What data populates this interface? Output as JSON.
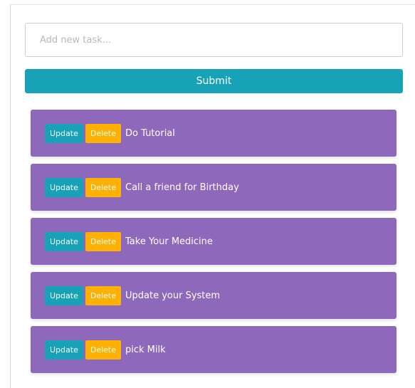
{
  "form": {
    "input_value": "",
    "input_placeholder": "Add new task...",
    "submit_label": "Submit"
  },
  "tasks": [
    {
      "update_label": "Update",
      "delete_label": "Delete",
      "text": "Do Tutorial"
    },
    {
      "update_label": "Update",
      "delete_label": "Delete",
      "text": "Call a friend for Birthday"
    },
    {
      "update_label": "Update",
      "delete_label": "Delete",
      "text": "Take Your Medicine"
    },
    {
      "update_label": "Update",
      "delete_label": "Delete",
      "text": "Update your System"
    },
    {
      "update_label": "Update",
      "delete_label": "Delete",
      "text": "pick Milk"
    }
  ],
  "colors": {
    "primary": "#17a2b8",
    "warning": "#ffb000",
    "task_background": "#8e68bb"
  }
}
